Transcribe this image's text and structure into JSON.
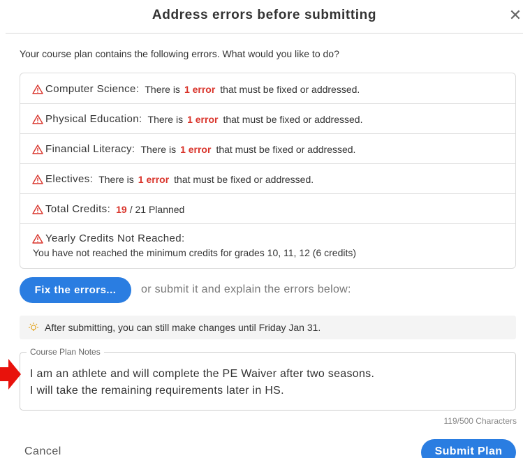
{
  "dialog": {
    "title": "Address errors before submitting",
    "close_glyph": "✕",
    "intro": "Your course plan contains the following errors. What would you like to do?"
  },
  "errors": [
    {
      "label": "Computer Science:",
      "prefix": "There is",
      "count": "1 error",
      "suffix": "that must be fixed or addressed."
    },
    {
      "label": "Physical Education:",
      "prefix": "There is",
      "count": "1 error",
      "suffix": "that must be fixed or addressed."
    },
    {
      "label": "Financial Literacy:",
      "prefix": "There is",
      "count": "1 error",
      "suffix": "that must be fixed or addressed."
    },
    {
      "label": "Electives:",
      "prefix": "There is",
      "count": "1 error",
      "suffix": "that must be fixed or addressed."
    }
  ],
  "total_credits": {
    "label": "Total Credits:",
    "current": "19",
    "rest": "/ 21 Planned"
  },
  "yearly_credits": {
    "label": "Yearly Credits Not Reached:",
    "detail": "You have not reached the minimum credits for grades 10, 11, 12 (6 credits)"
  },
  "actions": {
    "fix_label": "Fix the errors...",
    "or_text": "or submit it and explain the errors below:"
  },
  "info": {
    "icon": "lightbulb-icon",
    "text": "After submitting, you can still make changes until Friday Jan 31."
  },
  "notes": {
    "legend": "Course Plan Notes",
    "value": "I am an athlete and will complete the PE Waiver after two seasons.\nI will take the remaining requirements later in HS.",
    "char_count": "119/500 Characters"
  },
  "footer": {
    "cancel_label": "Cancel",
    "submit_label": "Submit Plan"
  },
  "colors": {
    "accent": "#2a7de1",
    "error": "#d9342b",
    "annotation_arrow": "#e8120c"
  }
}
